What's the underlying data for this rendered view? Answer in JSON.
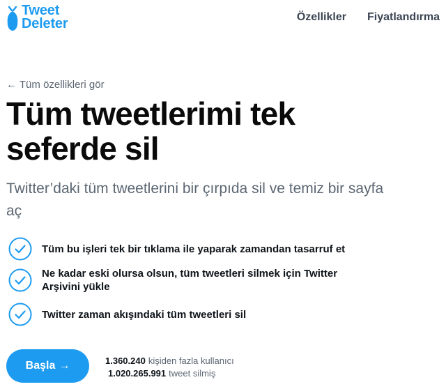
{
  "brand": {
    "line1": "Tweet",
    "line2": "Deleter",
    "icon": "bomb-icon",
    "color": "#1d9bf0"
  },
  "nav": {
    "features": "Özellikler",
    "pricing": "Fiyatlandırma"
  },
  "back_link": "← Tüm özellikleri gör",
  "hero": {
    "title": "Tüm tweetlerimi tek seferde sil",
    "subtitle": "Twitter’daki tüm tweetlerini bir çırpıda sil ve temiz bir sayfa aç"
  },
  "features": [
    {
      "icon": "check-circle-icon",
      "text": "Tüm bu işleri tek bir tıklama ile yaparak zamandan tasarruf et"
    },
    {
      "icon": "check-circle-icon",
      "text": "Ne kadar eski olursa olsun, tüm tweetleri silmek için Twitter Arşivini yükle"
    },
    {
      "icon": "check-circle-icon",
      "text": "Twitter zaman akışındaki tüm tweetleri sil"
    }
  ],
  "cta": {
    "label": "Başla",
    "arrow": "→"
  },
  "stats": {
    "users_count": "1.360.240",
    "users_label": "kişiden fazla kullanıcı",
    "tweets_count": "1.020.265.991",
    "tweets_label": "tweet silmiş"
  },
  "colors": {
    "accent": "#1d9bf0",
    "muted": "#5b6672"
  }
}
